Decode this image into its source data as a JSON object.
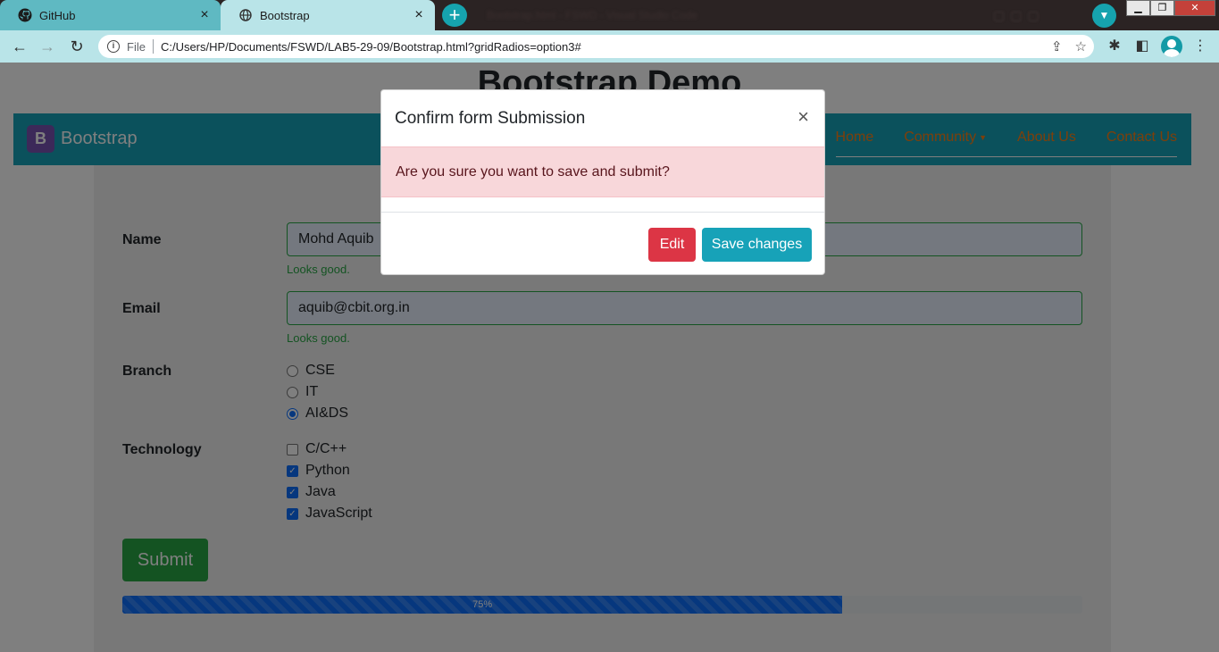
{
  "browser": {
    "tabs": [
      {
        "title": "GitHub",
        "icon": "github-icon"
      },
      {
        "title": "Bootstrap",
        "icon": "globe-icon"
      }
    ],
    "background_window_title": "Bootstrap.html - FSWD - Visual Studio Code",
    "address": {
      "scheme": "File",
      "url": "C:/Users/HP/Documents/FSWD/LAB5-29-09/Bootstrap.html?gridRadios=option3#"
    }
  },
  "page": {
    "heading": "Bootstrap Demo",
    "navbar": {
      "brand_letter": "B",
      "brand": "Bootstrap",
      "links": [
        "Home",
        "Community",
        "About Us",
        "Contact Us"
      ]
    },
    "form": {
      "name_label": "Name",
      "name_value": "Mohd Aquib",
      "name_feedback": "Looks good.",
      "email_label": "Email",
      "email_value": "aquib@cbit.org.in",
      "email_feedback": "Looks good.",
      "branch_label": "Branch",
      "branch_options": [
        {
          "label": "CSE",
          "checked": false
        },
        {
          "label": "IT",
          "checked": false
        },
        {
          "label": "AI&DS",
          "checked": true
        }
      ],
      "technology_label": "Technology",
      "technology_options": [
        {
          "label": "C/C++",
          "checked": false
        },
        {
          "label": "Python",
          "checked": true
        },
        {
          "label": "Java",
          "checked": true
        },
        {
          "label": "JavaScript",
          "checked": true
        }
      ],
      "submit_label": "Submit",
      "progress": {
        "percent": 75,
        "label": "75%"
      }
    }
  },
  "modal": {
    "title": "Confirm form Submission",
    "close_symbol": "×",
    "message": "Are you sure you want to save and submit?",
    "edit_label": "Edit",
    "save_label": "Save changes"
  },
  "colors": {
    "navbar": "#17a2b8",
    "nav_link": "#fd7e14",
    "success": "#28a745",
    "danger": "#dc3545",
    "alert_bg": "#f8d7da",
    "progress": "#0d6efd"
  }
}
